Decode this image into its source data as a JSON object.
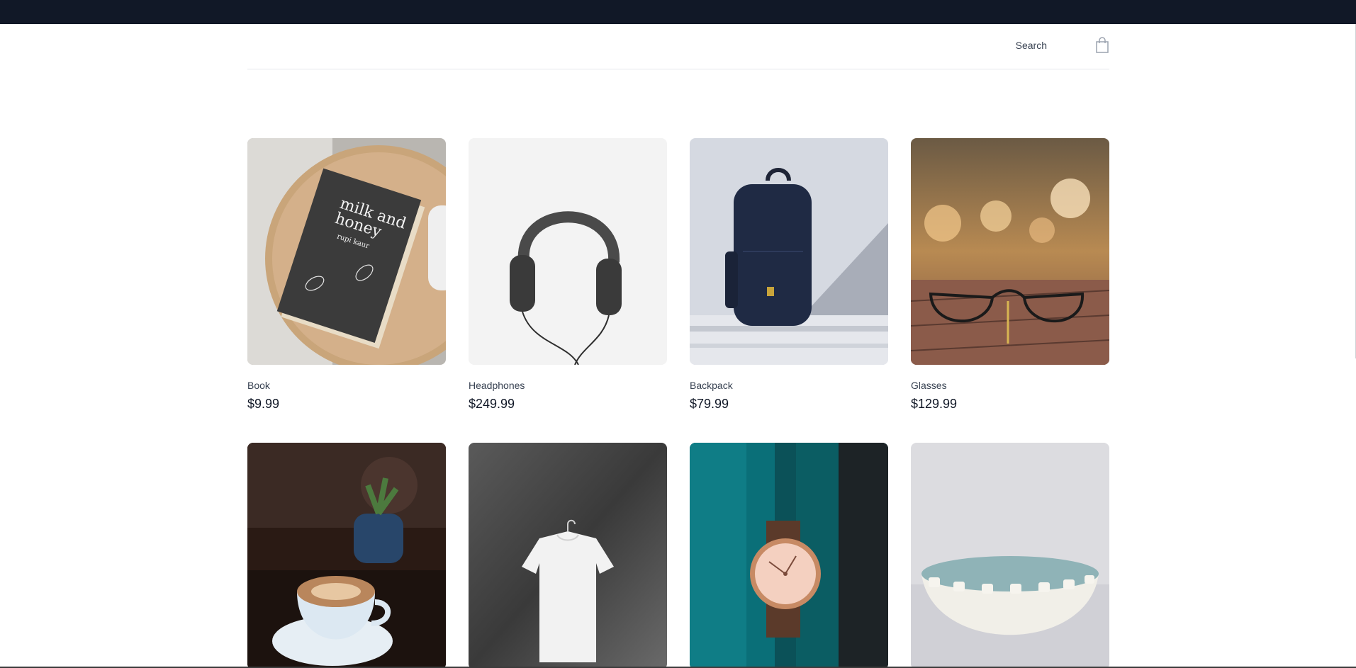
{
  "header": {
    "search_label": "Search",
    "cart_icon": "shopping-bag-icon"
  },
  "products": [
    {
      "name": "Book",
      "price": "$9.99",
      "image": "book-photo"
    },
    {
      "name": "Headphones",
      "price": "$249.99",
      "image": "headphones-photo"
    },
    {
      "name": "Backpack",
      "price": "$79.99",
      "image": "backpack-photo"
    },
    {
      "name": "Glasses",
      "price": "$129.99",
      "image": "glasses-photo"
    },
    {
      "name": "",
      "price": "",
      "image": "coffee-photo"
    },
    {
      "name": "",
      "price": "",
      "image": "tshirt-photo"
    },
    {
      "name": "",
      "price": "",
      "image": "watch-photo"
    },
    {
      "name": "",
      "price": "",
      "image": "bowl-photo"
    }
  ],
  "book_cover": {
    "title_line1": "milk and",
    "title_line2": "honey",
    "author": "rupi kaur"
  },
  "colors": {
    "banner": "#111827",
    "text_primary": "#111827",
    "text_secondary": "#374151",
    "divider": "#e5e7eb"
  }
}
